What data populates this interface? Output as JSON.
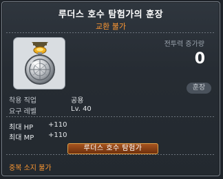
{
  "item": {
    "name": "루더스 호수 탐험가의 훈장",
    "trade_status": "교환 불가",
    "icon": "medal-icon"
  },
  "power": {
    "label": "전투력 증가량",
    "value": "0"
  },
  "category_badge": "훈장",
  "requirements": {
    "job_label": "착용 직업",
    "job_value": "공용",
    "level_label": "요구 레벨",
    "level_value": "Lv. 40"
  },
  "stats": [
    {
      "label": "최대 HP",
      "value": "+110"
    },
    {
      "label": "최대 MP",
      "value": "+110"
    }
  ],
  "title_tag": "루더스 호수 탐험가",
  "footer_note": "중복 소지 불가",
  "colors": {
    "accent_orange": "#ff9933",
    "background": "#2a3037",
    "title_button": "#8a4316"
  }
}
